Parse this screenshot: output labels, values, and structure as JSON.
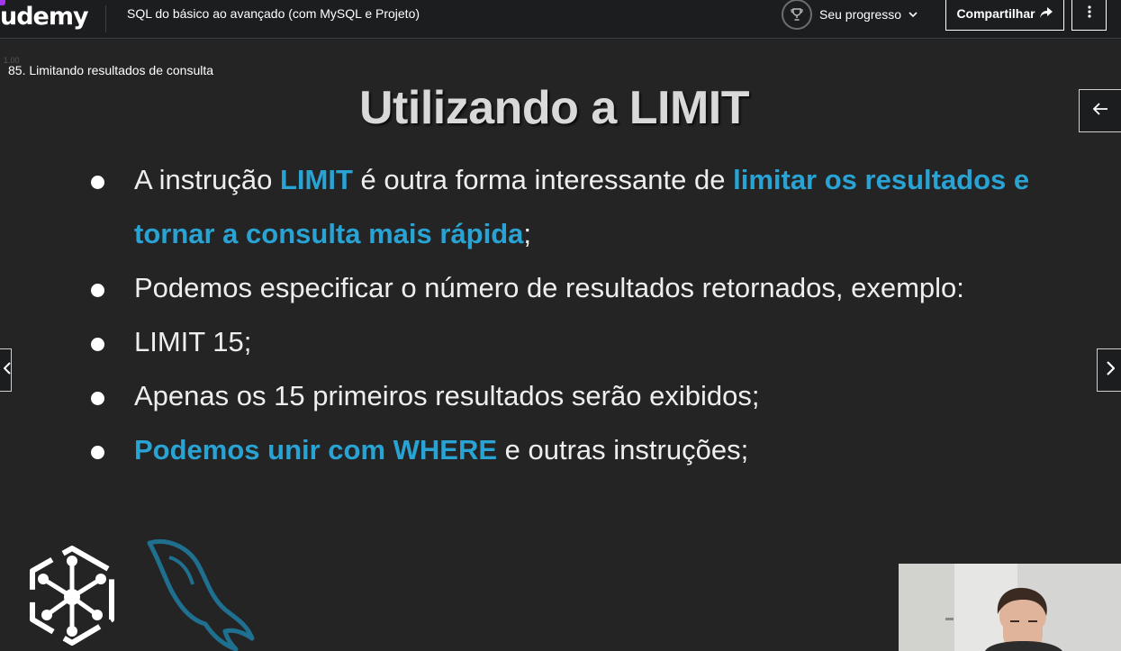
{
  "header": {
    "logo": "udemy",
    "course_title": "SQL do básico ao avançado (com MySQL e Projeto)",
    "progress_label": "Seu progresso",
    "share_label": "Compartilhar"
  },
  "player": {
    "rate_label": "1.00",
    "lecture_title": "85. Limitando resultados de consulta"
  },
  "slide": {
    "title": "Utilizando a LIMIT",
    "bullets": [
      {
        "segments": [
          {
            "text": "A instrução ",
            "highlight": false
          },
          {
            "text": "LIMIT",
            "highlight": true
          },
          {
            "text": " é outra forma interessante de ",
            "highlight": false
          },
          {
            "text": "limitar os resultados e tornar a consulta mais rápida",
            "highlight": true
          },
          {
            "text": ";",
            "highlight": false
          }
        ]
      },
      {
        "segments": [
          {
            "text": "Podemos especificar o número de resultados retornados, exemplo:",
            "highlight": false
          }
        ]
      },
      {
        "segments": [
          {
            "text": "LIMIT 15;",
            "highlight": false
          }
        ]
      },
      {
        "segments": [
          {
            "text": "Apenas os 15 primeiros resultados serão exibidos;",
            "highlight": false
          }
        ]
      },
      {
        "segments": [
          {
            "text": "Podemos unir com WHERE",
            "highlight": true
          },
          {
            "text": " e outras instruções;",
            "highlight": false
          }
        ]
      }
    ]
  },
  "icons": {
    "trophy": "trophy-icon",
    "chevron": "chevron-down-icon",
    "share": "share-arrow-icon",
    "more": "more-vertical-icon",
    "back": "arrow-left-icon",
    "prev": "chevron-left-icon",
    "next": "chevron-right-icon"
  },
  "colors": {
    "accent_blue": "#29a3d4",
    "brand_purple": "#a435f0",
    "background": "#1c1d1f"
  }
}
